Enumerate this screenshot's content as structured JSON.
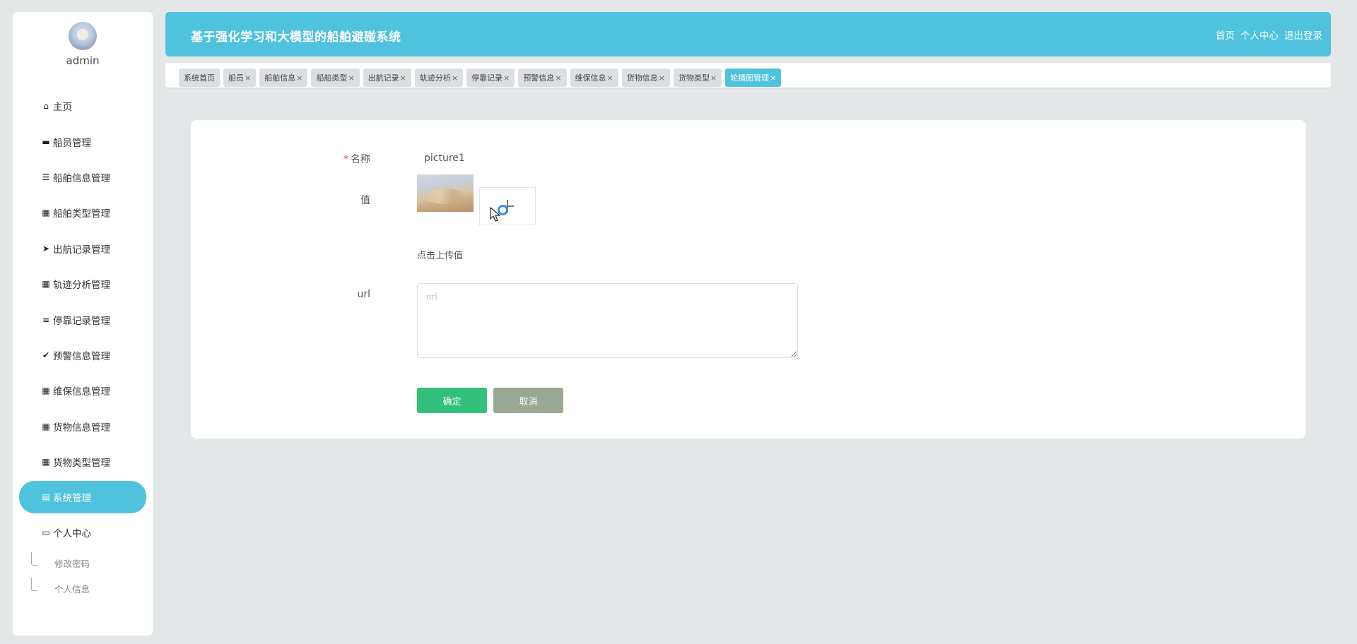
{
  "app": {
    "title": "基于强化学习和大模型的船舶避碰系统"
  },
  "header": {
    "links": [
      "首页",
      "个人中心",
      "退出登录"
    ]
  },
  "sidebar": {
    "username": "admin",
    "items": [
      {
        "label": "主页",
        "icon": "home-icon",
        "glyph": "⌂"
      },
      {
        "label": "船员管理",
        "icon": "monitor-icon",
        "glyph": "▬"
      },
      {
        "label": "船舶信息管理",
        "icon": "sliders-icon",
        "glyph": "☰"
      },
      {
        "label": "船舶类型管理",
        "icon": "grid-icon",
        "glyph": "▦"
      },
      {
        "label": "出航记录管理",
        "icon": "paper-plane-icon",
        "glyph": "➤"
      },
      {
        "label": "轨迹分析管理",
        "icon": "grid-icon",
        "glyph": "▦"
      },
      {
        "label": "停靠记录管理",
        "icon": "list-icon",
        "glyph": "≡"
      },
      {
        "label": "预警信息管理",
        "icon": "clipboard-check-icon",
        "glyph": "✔"
      },
      {
        "label": "维保信息管理",
        "icon": "grid-icon",
        "glyph": "▦"
      },
      {
        "label": "货物信息管理",
        "icon": "grid-icon",
        "glyph": "▦"
      },
      {
        "label": "货物类型管理",
        "icon": "grid-icon",
        "glyph": "▦"
      },
      {
        "label": "系统管理",
        "icon": "table-icon",
        "glyph": "▤",
        "active": true
      },
      {
        "label": "个人中心",
        "icon": "wallet-icon",
        "glyph": "▭"
      }
    ],
    "sub_items": [
      "修改密码",
      "个人信息"
    ]
  },
  "tabs": [
    {
      "label": "系统首页",
      "closable": false
    },
    {
      "label": "船员",
      "closable": true
    },
    {
      "label": "船舶信息",
      "closable": true
    },
    {
      "label": "船舶类型",
      "closable": true
    },
    {
      "label": "出航记录",
      "closable": true
    },
    {
      "label": "轨迹分析",
      "closable": true
    },
    {
      "label": "停靠记录",
      "closable": true
    },
    {
      "label": "预警信息",
      "closable": true
    },
    {
      "label": "维保信息",
      "closable": true
    },
    {
      "label": "货物信息",
      "closable": true
    },
    {
      "label": "货物类型",
      "closable": true
    },
    {
      "label": "轮播图管理",
      "closable": true,
      "active": true
    }
  ],
  "form": {
    "name_label": "名称",
    "name_value": "picture1",
    "value_label": "值",
    "upload_hint": "点击上传值",
    "url_label": "url",
    "url_placeholder": "url",
    "url_value": "",
    "confirm_label": "确定",
    "cancel_label": "取消"
  },
  "colors": {
    "accent": "#4fc3de",
    "confirm": "#33c07b",
    "cancel": "#9aa893",
    "background": "#e4e7e8"
  }
}
